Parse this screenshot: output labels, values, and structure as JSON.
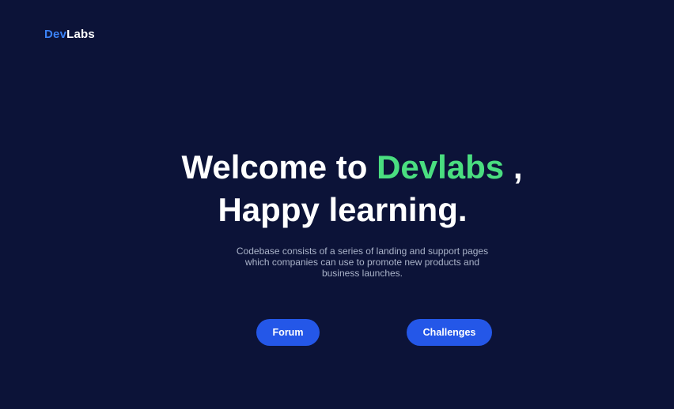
{
  "header": {
    "logo_part1": "Dev",
    "logo_part2": "Labs"
  },
  "hero": {
    "title_line1_prefix": "Welcome to ",
    "title_brand": "Devlabs",
    "title_line1_suffix": " ,",
    "title_line2": "Happy learning.",
    "subtitle_line1": "Codebase consists of a series of landing and support pages",
    "subtitle_line2": "which companies can use to promote new products and",
    "subtitle_line3": "business launches."
  },
  "actions": {
    "forum_label": "Forum",
    "challenges_label": "Challenges"
  },
  "colors": {
    "background": "#0c1338",
    "brand_green": "#4ade80",
    "logo_blue": "#3b82f6",
    "button_blue": "#2457e8"
  }
}
